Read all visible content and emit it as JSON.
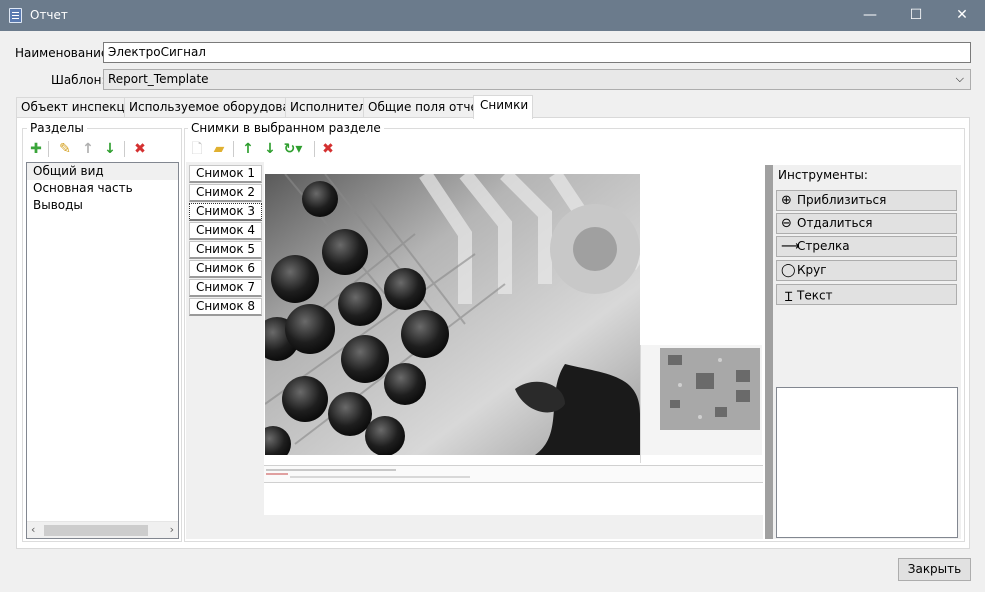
{
  "window": {
    "title": "Отчет",
    "minimize": "—",
    "maximize": "☐",
    "close": "✕"
  },
  "form": {
    "name_label": "Наименование:",
    "name_value": "ЭлектроСигнал",
    "template_label": "Шаблон:",
    "template_value": "Report_Template"
  },
  "tabs": [
    {
      "label": "Объект инспекции"
    },
    {
      "label": "Используемое оборудование"
    },
    {
      "label": "Исполнитель"
    },
    {
      "label": "Общие поля отчета"
    },
    {
      "label": "Снимки"
    }
  ],
  "sections": {
    "title": "Разделы",
    "items": [
      "Общий вид",
      "Основная часть",
      "Выводы"
    ],
    "selected_index": 0
  },
  "snapshots": {
    "title": "Снимки в выбранном разделе",
    "items": [
      "Снимок 1",
      "Снимок 2",
      "Снимок 3",
      "Снимок 4",
      "Снимок 5",
      "Снимок 6",
      "Снимок 7",
      "Снимок 8"
    ],
    "selected_index": 2
  },
  "tools": {
    "title": "Инструменты:",
    "items": [
      {
        "label": "Приблизиться",
        "icon": "zoom-in-icon"
      },
      {
        "label": "Отдалиться",
        "icon": "zoom-out-icon"
      },
      {
        "label": "Стрелка",
        "icon": "arrow-icon"
      },
      {
        "label": "Круг",
        "icon": "circle-icon"
      },
      {
        "label": "Текст",
        "icon": "text-cursor-icon"
      }
    ]
  },
  "footer": {
    "close_label": "Закрыть"
  },
  "colors": {
    "titlebar": "#6b7b8c",
    "add": "#3aa53a",
    "delete": "#d43030",
    "up_down": "#2e9e2e"
  }
}
